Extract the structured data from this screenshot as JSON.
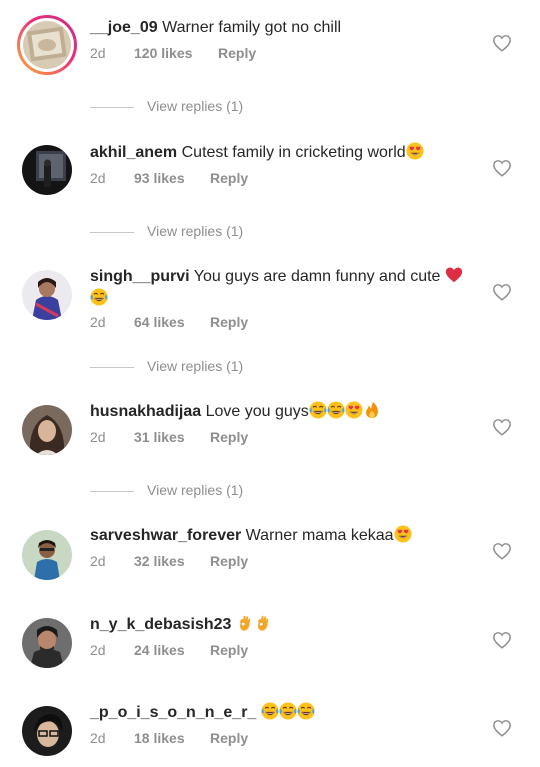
{
  "comments": [
    {
      "username": "__joe_09",
      "text": "Warner family got no chill",
      "time": "2d",
      "likes": "120 likes",
      "reply": "Reply",
      "view_replies": "View replies (1)",
      "avatar_icon": "story-ring-avatar",
      "emojis": []
    },
    {
      "username": "akhil_anem",
      "text": "Cutest family in cricketing world",
      "time": "2d",
      "likes": "93 likes",
      "reply": "Reply",
      "view_replies": "View replies (1)",
      "emojis": [
        "heart-eyes"
      ]
    },
    {
      "username": "singh__purvi",
      "text": "You guys are damn funny and cute",
      "time": "2d",
      "likes": "64 likes",
      "reply": "Reply",
      "view_replies": "View replies (1)",
      "emojis": [
        "red-heart",
        "tears-of-joy"
      ]
    },
    {
      "username": "husnakhadijaa",
      "text": "Love you guys",
      "time": "2d",
      "likes": "31 likes",
      "reply": "Reply",
      "view_replies": "View replies (1)",
      "emojis": [
        "tears-of-joy",
        "tears-of-joy",
        "heart-eyes",
        "fire"
      ]
    },
    {
      "username": "sarveshwar_forever",
      "text": "Warner mama kekaa",
      "time": "2d",
      "likes": "32 likes",
      "reply": "Reply",
      "emojis": [
        "heart-eyes"
      ]
    },
    {
      "username": "n_y_k_debasish23",
      "text": "",
      "time": "2d",
      "likes": "24 likes",
      "reply": "Reply",
      "emojis": [
        "ok-hand",
        "ok-hand"
      ]
    },
    {
      "username": "_p_o_i_s_o_n_n_e_r_",
      "text": "",
      "time": "2d",
      "likes": "18 likes",
      "reply": "Reply",
      "emojis": [
        "tears-of-joy",
        "tears-of-joy",
        "tears-of-joy"
      ]
    }
  ],
  "colors": {
    "text": "#262626",
    "muted": "#8e8e8e",
    "divider": "#c7c7c7",
    "heart_outline": "#8e8e8e"
  }
}
